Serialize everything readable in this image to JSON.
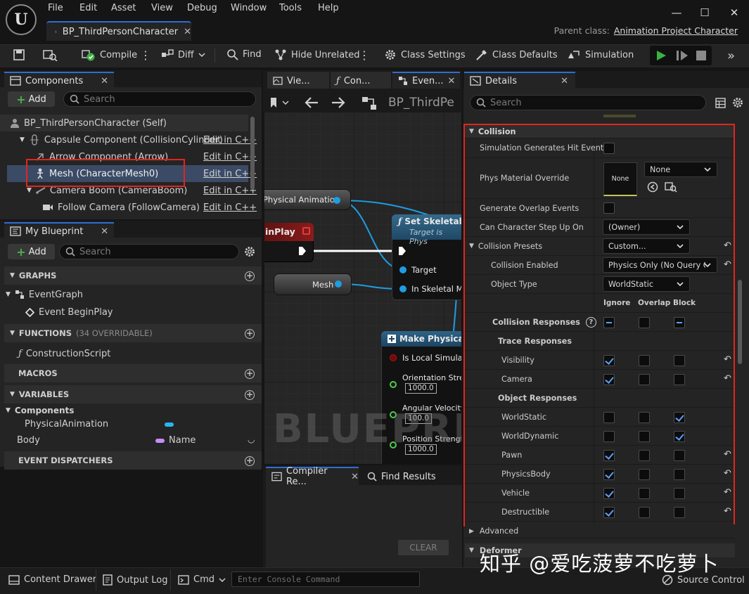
{
  "app": {
    "logo_letter": "U",
    "menu": [
      "File",
      "Edit",
      "Asset",
      "View",
      "Debug",
      "Window",
      "Tools",
      "Help"
    ],
    "document_tab": "BP_ThirdPersonCharacter",
    "parent_class_label": "Parent class:",
    "parent_class_value": "Animation Project Character"
  },
  "toolbar": {
    "compile": "Compile",
    "diff": "Diff",
    "find": "Find",
    "hide_unrelated": "Hide Unrelated",
    "class_settings": "Class Settings",
    "class_defaults": "Class Defaults",
    "simulation": "Simulation"
  },
  "components": {
    "tab": "Components",
    "add": "Add",
    "search_placeholder": "Search",
    "root": "BP_ThirdPersonCharacter (Self)",
    "items": [
      {
        "label": "Capsule Component (CollisionCylinder)",
        "edit": "Edit in C++"
      },
      {
        "label": "Arrow Component (Arrow)",
        "edit": "Edit in C++"
      },
      {
        "label": "Mesh (CharacterMesh0)",
        "edit": "Edit in C++"
      },
      {
        "label": "Camera Boom (CameraBoom)",
        "edit": "Edit in C++"
      },
      {
        "label": "Follow Camera (FollowCamera)",
        "edit": "Edit in C++"
      }
    ]
  },
  "my_blueprint": {
    "tab": "My Blueprint",
    "add": "Add",
    "search_placeholder": "Search",
    "graphs": "GRAPHS",
    "event_graph": "EventGraph",
    "event_begin_play": "Event BeginPlay",
    "functions": "FUNCTIONS",
    "functions_count": "(34 OVERRIDABLE)",
    "construction_script": "ConstructionScript",
    "macros": "MACROS",
    "variables": "VARIABLES",
    "components_group": "Components",
    "var_physical_animation": "PhysicalAnimation",
    "var_body": "Body",
    "var_body_type": "Name",
    "event_dispatchers": "EVENT DISPATCHERS"
  },
  "graph": {
    "tabs": [
      "Vie...",
      "Con...",
      "Even..."
    ],
    "breadcrumb": "BP_ThirdPe",
    "node_physical_animation": "Physical Animation",
    "node_begin_play": "ginPlay",
    "node_mesh": "Mesh",
    "node_set_skeletal_title": "Set Skeletal M",
    "node_set_skeletal_sub": "Target is Phys",
    "pin_target": "Target",
    "pin_in_skeletal": "In Skeletal Me",
    "node_make_title": "Make PhysicalAn",
    "pin_is_local": "Is Local Simulati",
    "pin_orientation": "Orientation Strer",
    "pin_orientation_val": "1000.0",
    "pin_angular": "Angular Velocity",
    "pin_angular_val": "100.0",
    "pin_position": "Position Strengtl",
    "pin_position_val": "1000.0",
    "watermark": "BLUEPRIN"
  },
  "bottom_tabs": {
    "compiler_results": "Compiler Re...",
    "find_results": "Find Results",
    "clear": "CLEAR"
  },
  "details": {
    "tab": "Details",
    "search_placeholder": "Search",
    "collision": "Collision",
    "sim_hit": "Simulation Generates Hit Events",
    "phys_material": "Phys Material Override",
    "phys_material_thumb": "None",
    "phys_material_value": "None",
    "gen_overlap": "Generate Overlap Events",
    "step_up": "Can Character Step Up On",
    "step_up_value": "(Owner)",
    "presets": "Collision Presets",
    "presets_value": "Custom...",
    "collision_enabled": "Collision Enabled",
    "collision_enabled_value": "Physics Only (No Query C",
    "object_type": "Object Type",
    "object_type_value": "WorldStatic",
    "col_ignore": "Ignore",
    "col_overlap": "Overlap",
    "col_block": "Block",
    "collision_responses": "Collision Responses",
    "trace_responses": "Trace Responses",
    "object_responses": "Object Responses",
    "rows": [
      {
        "label": "Visibility",
        "state": "ignore"
      },
      {
        "label": "Camera",
        "state": "ignore"
      },
      {
        "label": "WorldStatic",
        "state": "block"
      },
      {
        "label": "WorldDynamic",
        "state": "block"
      },
      {
        "label": "Pawn",
        "state": "ignore"
      },
      {
        "label": "PhysicsBody",
        "state": "ignore"
      },
      {
        "label": "Vehicle",
        "state": "ignore"
      },
      {
        "label": "Destructible",
        "state": "ignore"
      }
    ],
    "advanced": "Advanced",
    "deformer": "Deformer"
  },
  "statusbar": {
    "content_drawer": "Content Drawer",
    "output_log": "Output Log",
    "cmd": "Cmd",
    "console_placeholder": "Enter Console Command",
    "source_control": "Source Control"
  },
  "watermark_text": "知乎 @爱吃菠萝不吃萝卜",
  "colors": {
    "accent": "#2f6dd6",
    "highlight": "#e0261f",
    "pin": "#1e9de0",
    "check": "#5aa0ff"
  }
}
